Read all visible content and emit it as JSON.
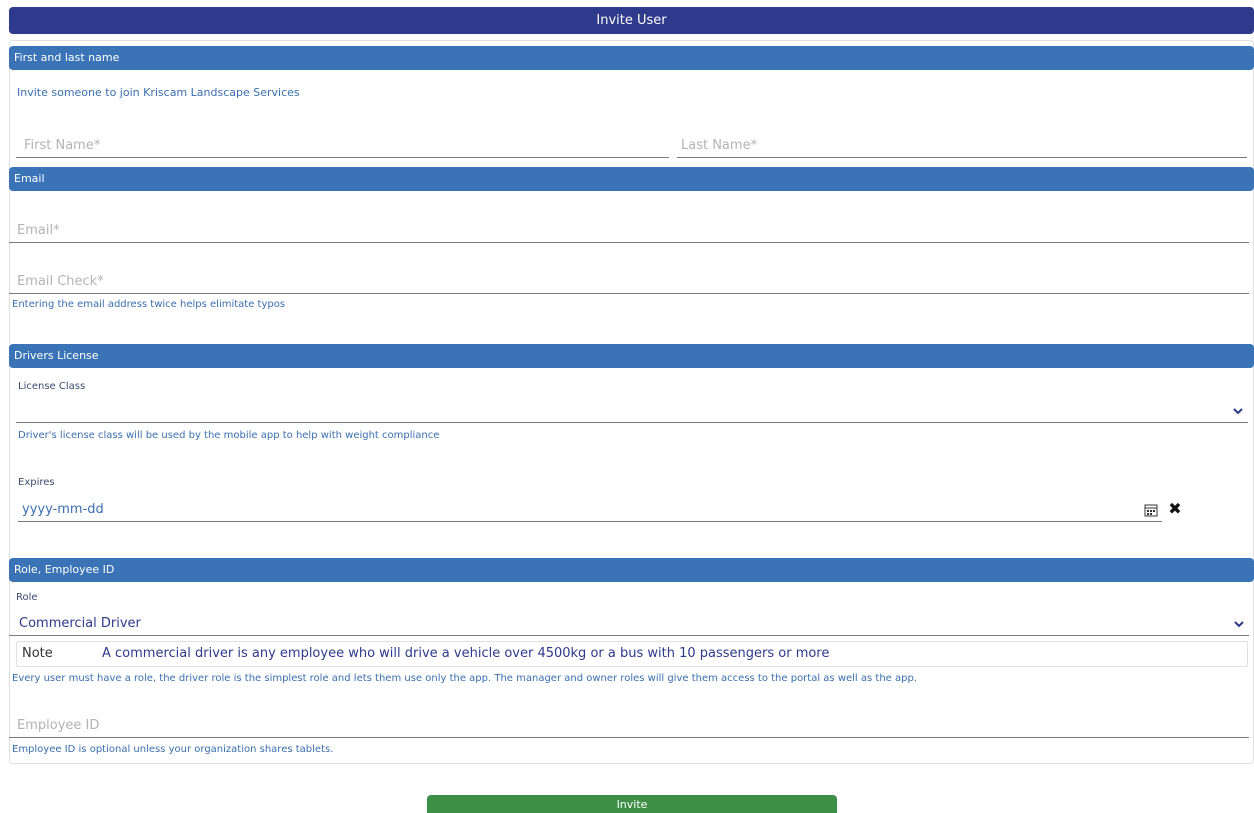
{
  "header": {
    "title": "Invite User"
  },
  "sections": {
    "name": {
      "title": "First and last name",
      "intro": "Invite someone to join Kriscam Landscape Services",
      "first_name_placeholder": "First Name*",
      "last_name_placeholder": "Last Name*"
    },
    "email": {
      "title": "Email",
      "email_placeholder": "Email*",
      "email_check_placeholder": "Email Check*",
      "helper": "Entering the email address twice helps elimitate typos"
    },
    "license": {
      "title": "Drivers License",
      "class_label": "License Class",
      "class_value": "",
      "class_helper": "Driver's license class will be used by the mobile app to help with weight compliance",
      "expires_label": "Expires",
      "expires_placeholder": "yyyy-mm-dd"
    },
    "role": {
      "title": "Role, Employee ID",
      "role_label": "Role",
      "role_value": "Commercial Driver",
      "note_label": "Note",
      "note_text": "A commercial driver is any employee who will drive a vehicle over 4500kg or a bus with 10 passengers or more",
      "role_helper": "Every user must have a role, the driver role is the simplest role and lets them use only the app. The manager and owner roles will give them access to the portal as well as the app.",
      "employee_id_placeholder": "Employee ID",
      "employee_id_helper": "Employee ID is optional unless your organization shares tablets."
    }
  },
  "actions": {
    "invite_label": "Invite"
  },
  "icons": {
    "select": "chevron-down-icon",
    "calendar": "calendar-icon",
    "clear": "close-icon"
  },
  "colors": {
    "title_bar": "#2e3a8c",
    "section_bar": "#3a74b7",
    "helper_text": "#3a6fb0",
    "invite_button": "#3e8f46"
  }
}
